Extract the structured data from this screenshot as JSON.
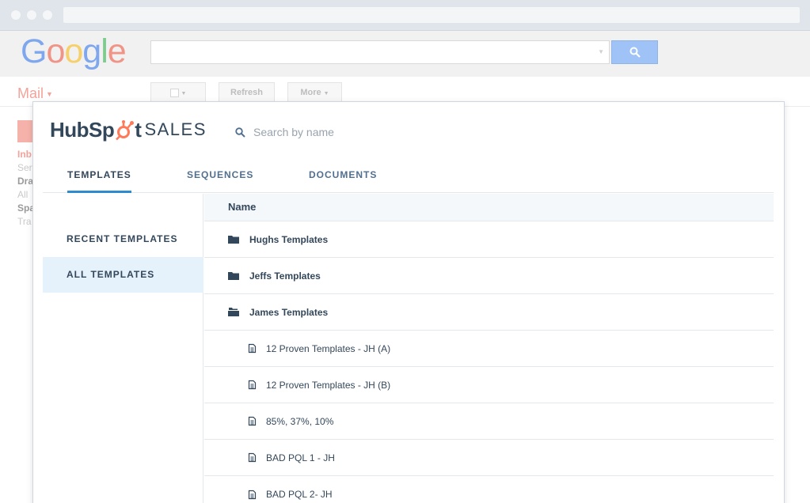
{
  "gmail": {
    "logo_letters": [
      {
        "char": "G",
        "color": "#7fa7ee"
      },
      {
        "char": "o",
        "color": "#f09488"
      },
      {
        "char": "o",
        "color": "#f6d06b"
      },
      {
        "char": "g",
        "color": "#7fa7ee"
      },
      {
        "char": "l",
        "color": "#7fcb8f"
      },
      {
        "char": "e",
        "color": "#f09488"
      }
    ],
    "mail_label": "Mail",
    "refresh_label": "Refresh",
    "more_label": "More",
    "sidebar": [
      "Inb",
      "Ser",
      "Dra",
      "All",
      "Spa",
      "Tra"
    ]
  },
  "hubspot": {
    "brand_left": "HubSp",
    "brand_right": "t",
    "product": "SALES",
    "search_placeholder": "Search by name",
    "tabs": [
      "TEMPLATES",
      "SEQUENCES",
      "DOCUMENTS"
    ],
    "nav": [
      "RECENT TEMPLATES",
      "ALL TEMPLATES"
    ],
    "column_header": "Name",
    "rows": [
      {
        "type": "folder",
        "label": "Hughs Templates"
      },
      {
        "type": "folder",
        "label": "Jeffs Templates"
      },
      {
        "type": "folder-open",
        "label": "James Templates"
      },
      {
        "type": "file",
        "label": "12 Proven Templates - JH (A)"
      },
      {
        "type": "file",
        "label": "12 Proven Templates - JH (B)"
      },
      {
        "type": "file",
        "label": "85%, 37%, 10%"
      },
      {
        "type": "file",
        "label": "BAD PQL 1 - JH"
      },
      {
        "type": "file",
        "label": "BAD PQL 2- JH"
      }
    ]
  },
  "colors": {
    "accent": "#2e8bd0",
    "text": "#33475b",
    "sprocket": "#ff7a59",
    "nav_selected": "#e5f1fb"
  }
}
